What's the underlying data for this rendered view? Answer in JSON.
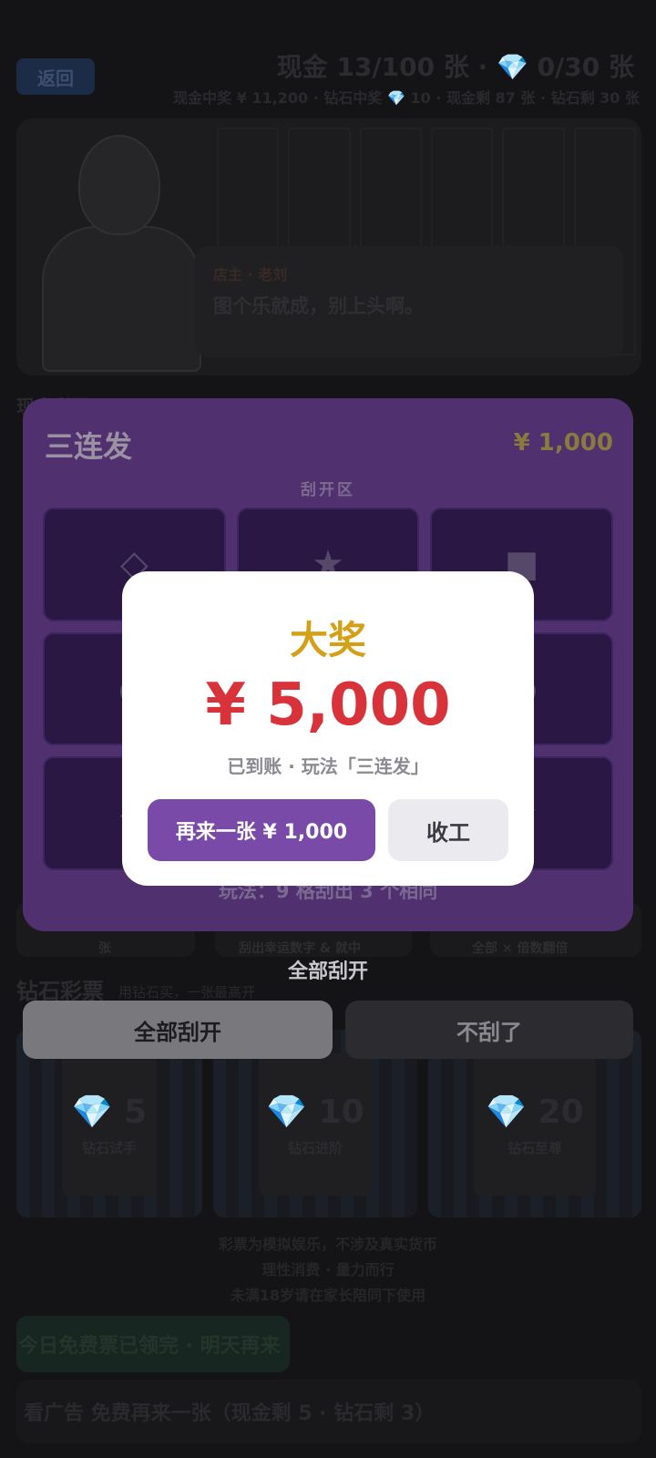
{
  "header": {
    "back_label": "返回",
    "count_title": "现金 13/100 张 · 💎 0/30 张",
    "count_sub": "现金中奖 ¥ 11,200 · 钻石中奖 💎 10 · 现金剩 87 张 · 钻石剩 30 张"
  },
  "shopkeeper": {
    "name": "店主 · 老刘",
    "speech": "图个乐就成，别上头啊。"
  },
  "background": {
    "section_label": "现金彩票",
    "stub_texts": [
      "张",
      "刮出幸运数字 & 就中",
      "全部 × 倍数翻倍"
    ],
    "diamond_section_label": "钻石彩票",
    "diamond_section_sub": "用钻石买，一张最高开",
    "diamond_cards": [
      {
        "price": "💎 5",
        "name": "钻石试手"
      },
      {
        "price": "💎 10",
        "name": "钻石进阶"
      },
      {
        "price": "💎 20",
        "name": "钻石至尊"
      }
    ],
    "notes": [
      "彩票为模拟娱乐，不涉及真实货币",
      "理性消费 · 量力而行",
      "未满18岁请在家长陪同下使用"
    ],
    "free_badge": "今日免费票已领完 · 明天再来",
    "ad_button": "看广告 免费再来一张（现金剩 5 · 钻石剩 3）"
  },
  "scratch": {
    "game_name": "三连发",
    "price": "¥ 1,000",
    "zone_label": "刮开区",
    "cells": [
      "◇",
      "★",
      "■",
      "●",
      "",
      "●",
      "◇",
      "",
      "★"
    ],
    "rule": "玩法：9 格刮出 3 个相同",
    "all_scratch_label": "全部刮开",
    "scratch_all_button": "全部刮开",
    "stop_button": "不刮了"
  },
  "dialog": {
    "title": "大奖",
    "amount": "¥ 5,000",
    "note": "已到账 · 玩法「三连发」",
    "again_button": "再来一张 ¥ 1,000",
    "quit_button": "收工"
  },
  "colors": {
    "accent_purple": "#7a4aa8",
    "prize_gold": "#d4a017",
    "prize_red": "#d8323a"
  }
}
